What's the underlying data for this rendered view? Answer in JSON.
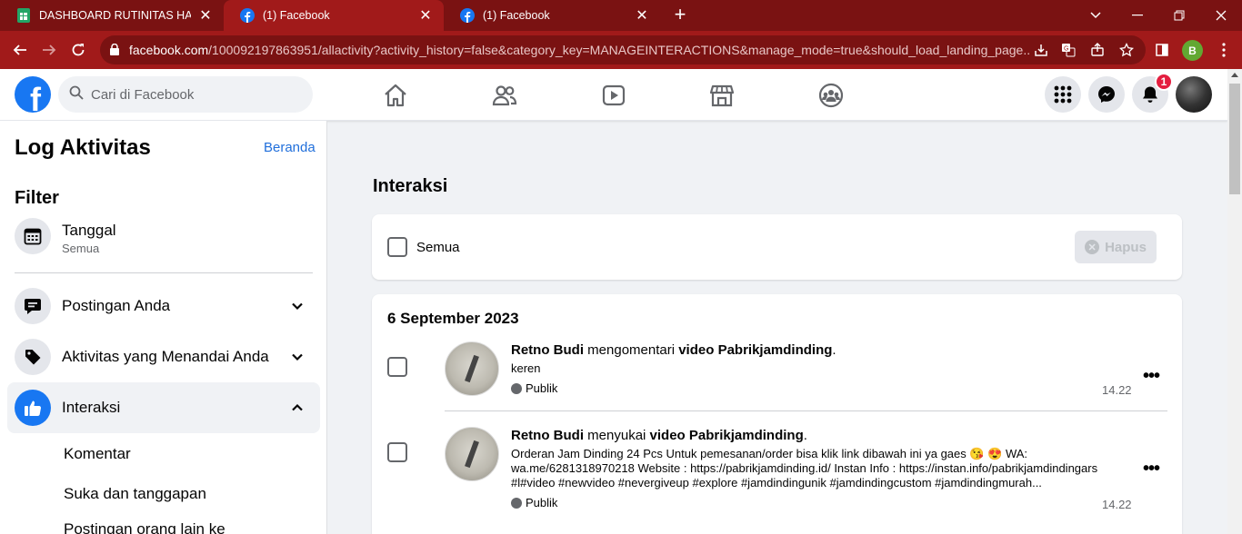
{
  "browser": {
    "tabs": [
      {
        "title": "DASHBOARD RUTINITAS HARIAN",
        "favicon": "sheets-icon"
      },
      {
        "title": "(1) Facebook",
        "favicon": "facebook-icon"
      },
      {
        "title": "(1) Facebook",
        "favicon": "facebook-icon"
      }
    ],
    "url_domain": "facebook.com",
    "url_rest": "/100092197863951/allactivity?activity_history=false&category_key=MANAGEINTERACTIONS&manage_mode=true&should_load_landing_page...",
    "profile_initial": "B",
    "colors": {
      "frame": "#7a1212",
      "toolbar": "#a11a1a"
    }
  },
  "header": {
    "logo": "f",
    "search_placeholder": "Cari di Facebook",
    "notification_count": "1",
    "accent": "#1877f2"
  },
  "sidebar": {
    "title": "Log Aktivitas",
    "home_link": "Beranda",
    "filter_label": "Filter",
    "date_filter": {
      "label": "Tanggal",
      "value": "Semua"
    },
    "categories": [
      {
        "label": "Postingan Anda",
        "icon": "comment-icon"
      },
      {
        "label": "Aktivitas yang Menandai Anda",
        "icon": "tag-icon"
      },
      {
        "label": "Interaksi",
        "icon": "thumbs-up-icon"
      }
    ],
    "sub_items": [
      "Komentar",
      "Suka dan tanggapan",
      "Postingan orang lain ke"
    ]
  },
  "main": {
    "title": "Interaksi",
    "select_all": "Semua",
    "delete_button": "Hapus",
    "date_heading": "6 September 2023",
    "items": [
      {
        "actor": "Retno Budi",
        "verb": " mengomentari ",
        "object": "video Pabrikjamdinding",
        "end": ".",
        "text": "keren",
        "privacy": "Publik",
        "time": "14.22"
      },
      {
        "actor": "Retno Budi",
        "verb": " menyukai ",
        "object": "video Pabrikjamdinding",
        "end": ".",
        "text": "Orderan Jam Dinding 24 Pcs Untuk pemesanan/order bisa klik link dibawah ini ya gaes 😘 😍  WA: wa.me/6281318970218 Website : https://pabrikjamdinding.id/ Instan Info : https://instan.info/pabrikjamdindingars #l#video #newvideo #nevergiveup #explore #jamdindingunik #jamdindingcustom #jamdindingmurah...",
        "privacy": "Publik",
        "time": "14.22"
      }
    ]
  }
}
